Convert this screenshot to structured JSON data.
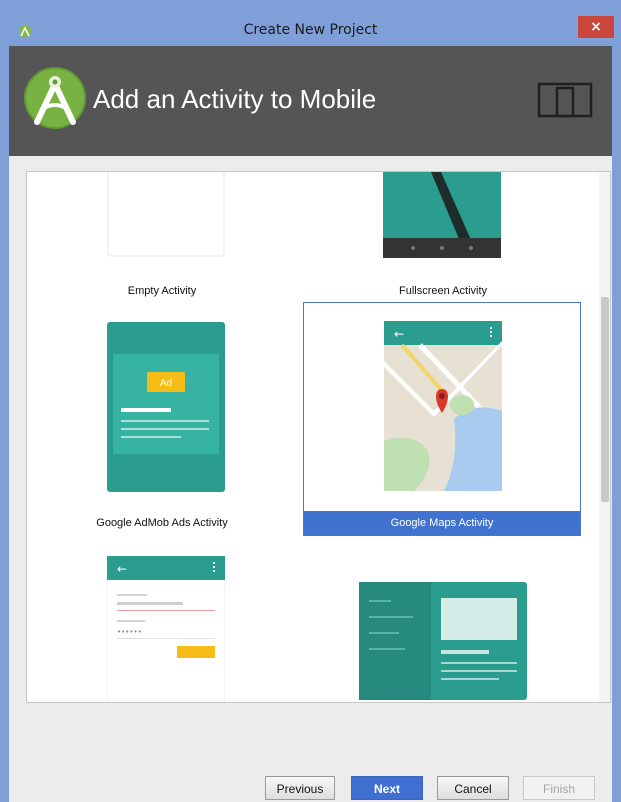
{
  "window": {
    "title": "Create New Project",
    "close_label": "×"
  },
  "header": {
    "heading": "Add an Activity to Mobile",
    "logo_icon": "android-studio-logo",
    "device_icon": "phone-tablet-icon"
  },
  "gallery": {
    "items": [
      {
        "label": "Empty Activity"
      },
      {
        "label": "Fullscreen Activity"
      },
      {
        "label": "Google AdMob Ads Activity",
        "badge": "Ad"
      },
      {
        "label": "Google Maps Activity",
        "selected": true
      },
      {
        "label": ""
      },
      {
        "label": ""
      }
    ]
  },
  "buttons": {
    "previous": "Previous",
    "next": "Next",
    "cancel": "Cancel",
    "finish": "Finish"
  },
  "colors": {
    "teal": "#2a9d8f",
    "selection": "#3f73cf",
    "header_bg": "#555555",
    "title_bar": "#7f9fd8"
  }
}
